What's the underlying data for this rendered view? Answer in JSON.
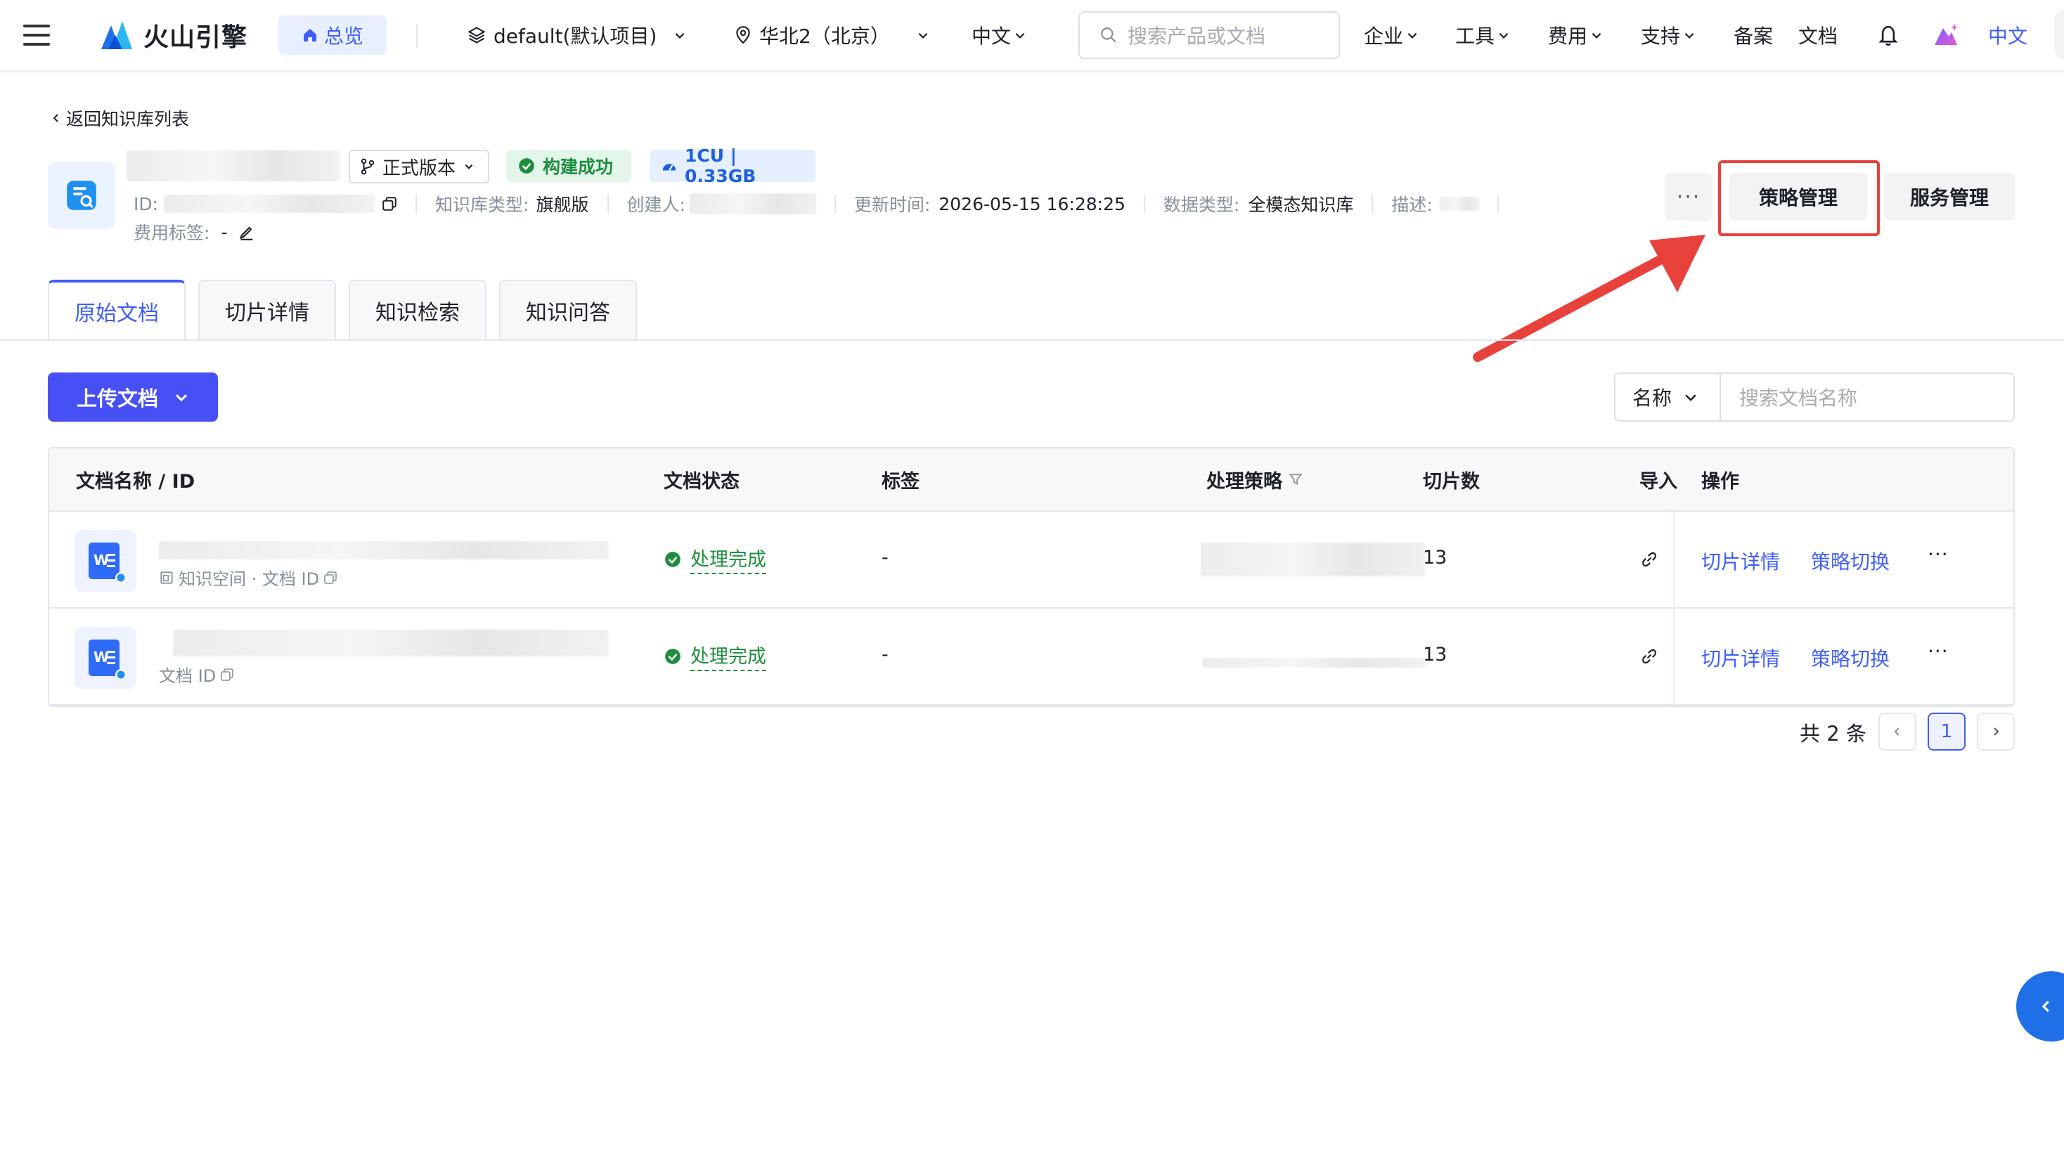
{
  "topbar": {
    "brand": "火山引擎",
    "overview": "总览",
    "project": "default(默认项目)",
    "region": "华北2（北京）",
    "language_menu": "中文",
    "search_placeholder": "搜索产品或文档",
    "nav": [
      "企业",
      "工具",
      "费用",
      "支持"
    ],
    "record": "备案",
    "docs": "文档",
    "lang_right": "中文"
  },
  "breadcrumb": {
    "back": "返回知识库列表"
  },
  "kb": {
    "version": "正式版本",
    "build_status": "构建成功",
    "capacity": "1CU | 0.33GB",
    "id_label": "ID:",
    "type_label": "知识库类型:",
    "type_value": "旗舰版",
    "creator_label": "创建人:",
    "updated_label": "更新时间:",
    "updated_value": "2026-05-15 16:28:25",
    "data_type_label": "数据类型:",
    "data_type_value": "全模态知识库",
    "desc_label": "描述:",
    "fee_tag_label": "费用标签:",
    "fee_tag_value": "-"
  },
  "header_actions": {
    "more": "···",
    "strategy": "策略管理",
    "service": "服务管理"
  },
  "tabs": [
    "原始文档",
    "切片详情",
    "知识检索",
    "知识问答"
  ],
  "toolbar": {
    "upload": "上传文档",
    "filter_field": "名称",
    "filter_placeholder": "搜索文档名称"
  },
  "table": {
    "columns": {
      "name": "文档名称 / ID",
      "status": "文档状态",
      "tags": "标签",
      "strategy": "处理策略",
      "chunks": "切片数",
      "import": "导入",
      "ops": "操作"
    },
    "rows": [
      {
        "sub": "知识空间 · 文档 ID",
        "status": "处理完成",
        "tags": "-",
        "chunks": "13",
        "op1": "切片详情",
        "op2": "策略切换",
        "more": "···"
      },
      {
        "sub": "文档 ID",
        "status": "处理完成",
        "tags": "-",
        "chunks": "13",
        "op1": "切片详情",
        "op2": "策略切换",
        "more": "···"
      }
    ]
  },
  "pagination": {
    "total": "共 2 条",
    "current": "1"
  },
  "colors": {
    "primary": "#3f5ef8",
    "success": "#1e8e3e",
    "highlight": "#e8413c"
  }
}
